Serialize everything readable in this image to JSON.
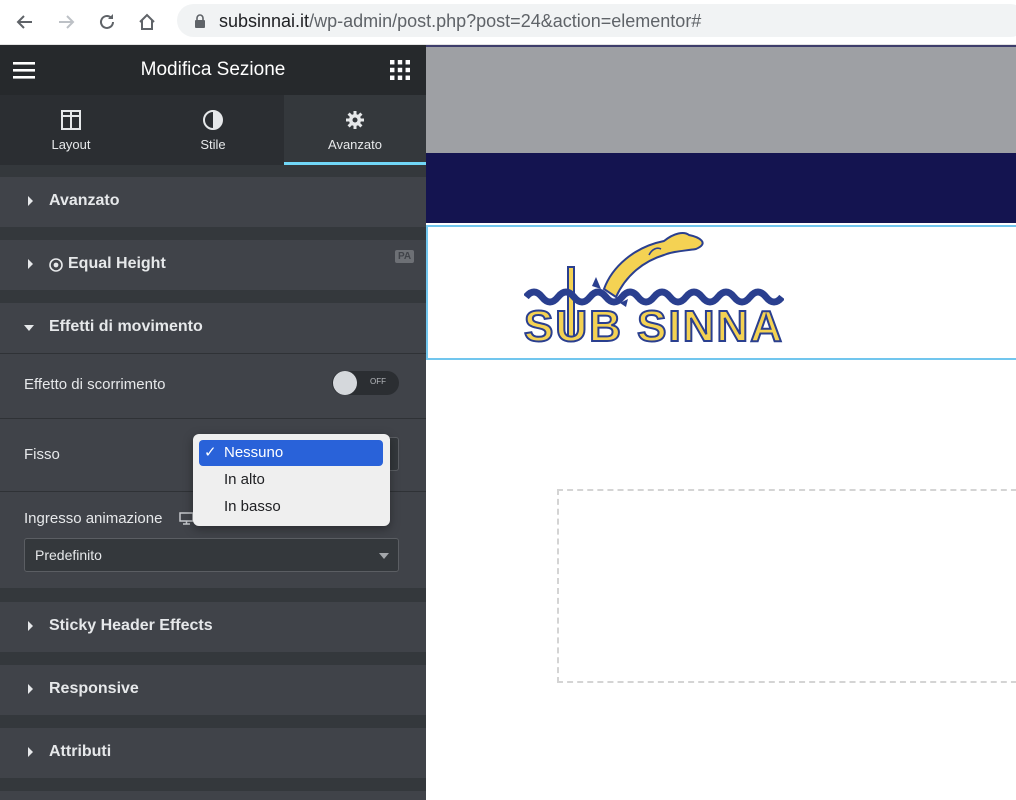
{
  "browser": {
    "url_host": "subsinnai.it",
    "url_path": "/wp-admin/post.php?post=24&action=elementor#"
  },
  "panel": {
    "title": "Modifica Sezione",
    "tabs": [
      {
        "label": "Layout",
        "icon": "layout-icon"
      },
      {
        "label": "Stile",
        "icon": "contrast-icon"
      },
      {
        "label": "Avanzato",
        "icon": "gear-icon",
        "active": true
      }
    ],
    "sections": {
      "avanzato": "Avanzato",
      "equal_height": "Equal Height",
      "equal_height_badge": "PA",
      "effetti": "Effetti di movimento",
      "sticky": "Sticky Header Effects",
      "responsive": "Responsive",
      "attributi": "Attributi"
    },
    "motion": {
      "scroll_label": "Effetto di scorrimento",
      "scroll_toggle_text": "OFF",
      "scroll_enabled": false,
      "fixed_label": "Fisso",
      "entrance_label": "Ingresso animazione",
      "entrance_value": "Predefinito"
    }
  },
  "dropdown": {
    "options": [
      "Nessuno",
      "In alto",
      "In basso"
    ],
    "selected": "Nessuno",
    "check": "✓"
  },
  "canvas": {
    "logo_text": "SUB SINNAI",
    "colors": {
      "gray": "#9ea0a4",
      "navy": "#141450",
      "logo_blue": "#2a3f8f",
      "logo_yellow": "#f4d253"
    }
  }
}
